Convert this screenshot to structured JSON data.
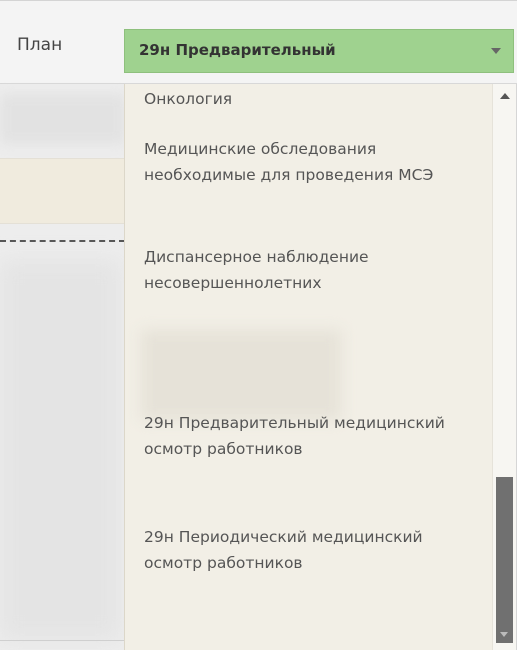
{
  "header": {
    "plan_label": "План",
    "plan_selected_value": "29н Предварительный"
  },
  "dropdown": {
    "items": [
      {
        "label": "Онкология"
      },
      {
        "label": "Медицинские обследования необходимые для проведения МСЭ"
      },
      {
        "label": "Диспансерное наблюдение несовершеннолетних"
      },
      {
        "label": "29н Предварительный медицинский осмотр работников"
      },
      {
        "label": "29н Периодический медицинский осмотр работников"
      }
    ]
  },
  "colors": {
    "select_bg": "#9fd28f",
    "dropdown_bg": "#f2efe6",
    "scroll_thumb": "#707070"
  }
}
